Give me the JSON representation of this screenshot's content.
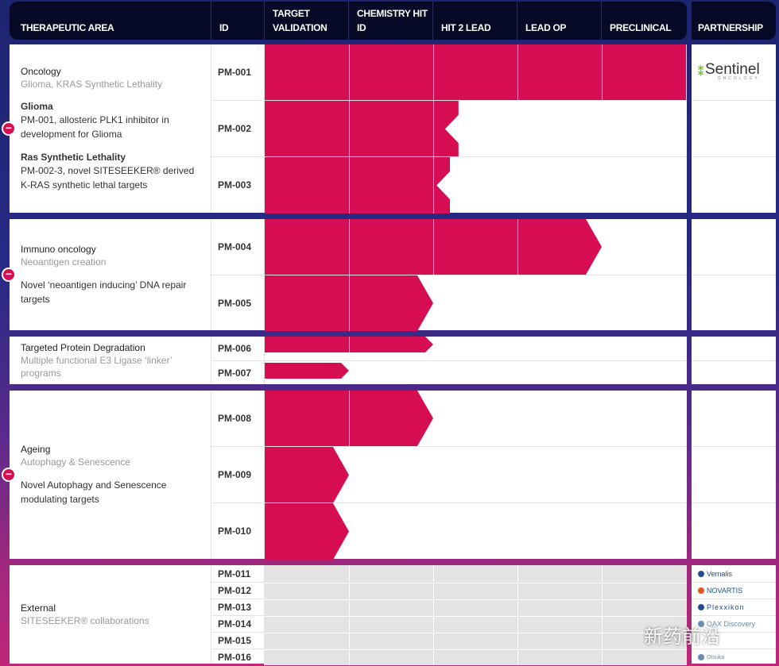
{
  "header": {
    "area": "THERAPEUTIC AREA",
    "id": "ID",
    "stages": [
      "TARGET VALIDATION",
      "CHEMISTRY HIT ID",
      "HIT 2 LEAD",
      "LEAD OP",
      "PRECLINICAL"
    ],
    "partnership": "PARTNERSHIP"
  },
  "colors": {
    "bar": "#d60d52",
    "header": "#070a26",
    "external": "#e3e3e3"
  },
  "groups": [
    {
      "title": "Oncology",
      "subtitle": "Glioma, KRAS Synthetic Lethality",
      "details": [
        {
          "title": "Glioma",
          "text": "PM-001, allosteric PLK1 inhibitor in development for Glioma"
        },
        {
          "title": "Ras Synthetic Lethality",
          "text": "PM-002-3, novel SITESEEKER® derived K-RAS synthetic lethal targets"
        }
      ],
      "collapse": true,
      "rows": [
        {
          "id": "PM-001",
          "progress": 5,
          "end": "flat",
          "partner": "Sentinel",
          "partner_sub": "ONCOLOGY"
        },
        {
          "id": "PM-002",
          "progress": 2.3,
          "end": "notch"
        },
        {
          "id": "PM-003",
          "progress": 2.2,
          "end": "notch"
        }
      ]
    },
    {
      "title": "Immuno oncology",
      "subtitle": "Neoantigen creation",
      "details": [
        {
          "title": "",
          "text": "Novel ‘neoantigen inducing’ DNA repair targets"
        }
      ],
      "collapse": true,
      "rows": [
        {
          "id": "PM-004",
          "progress": 4,
          "end": "arrow"
        },
        {
          "id": "PM-005",
          "progress": 2,
          "end": "arrow"
        }
      ]
    },
    {
      "title": "Targeted Protein Degradation",
      "subtitle": "Multiple functional E3 Ligase ‘linker’ programs",
      "details": [],
      "collapse": false,
      "rows": [
        {
          "id": "PM-006",
          "progress": 2,
          "end": "arrow"
        },
        {
          "id": "PM-007",
          "progress": 1,
          "end": "arrow"
        }
      ]
    },
    {
      "title": "Ageing",
      "subtitle": "Autophagy & Senescence",
      "details": [
        {
          "title": "",
          "text": "Novel Autophagy and Senescence modulating targets"
        }
      ],
      "collapse": true,
      "rows": [
        {
          "id": "PM-008",
          "progress": 2,
          "end": "arrow"
        },
        {
          "id": "PM-009",
          "progress": 1,
          "end": "arrow"
        },
        {
          "id": "PM-010",
          "progress": 1,
          "end": "arrow"
        }
      ]
    },
    {
      "title": "External",
      "subtitle": "SITESEEKER® collaborations",
      "details": [],
      "collapse": false,
      "external": true,
      "rows": [
        {
          "id": "PM-011",
          "partner": "Vernalis"
        },
        {
          "id": "PM-012",
          "partner": "NOVARTIS"
        },
        {
          "id": "PM-013",
          "partner": "Plexxikon"
        },
        {
          "id": "PM-014",
          "partner": "OAX Discovery"
        },
        {
          "id": "PM-015",
          "partner": ""
        },
        {
          "id": "PM-016",
          "partner": "Otsuka"
        }
      ]
    }
  ],
  "watermark": "新药前沿"
}
